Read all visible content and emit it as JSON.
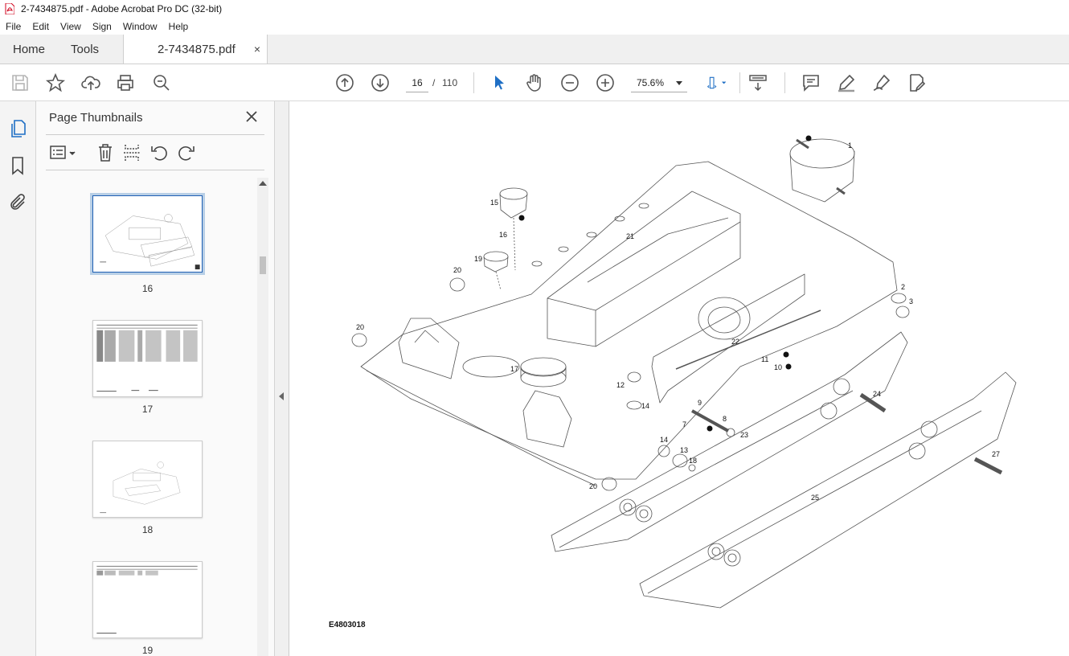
{
  "window": {
    "title": "2-7434875.pdf - Adobe Acrobat Pro DC (32-bit)"
  },
  "menu": [
    "File",
    "Edit",
    "View",
    "Sign",
    "Window",
    "Help"
  ],
  "tabs": {
    "home": "Home",
    "tools": "Tools",
    "document": "2-7434875.pdf",
    "close": "×"
  },
  "nav": {
    "current_page": "16",
    "separator": "/",
    "total_pages": "110",
    "zoom": "75.6%"
  },
  "panel": {
    "title": "Page Thumbnails"
  },
  "thumbnails": [
    {
      "label": "16",
      "selected": true
    },
    {
      "label": "17",
      "selected": false
    },
    {
      "label": "18",
      "selected": false
    },
    {
      "label": "19",
      "selected": false
    }
  ],
  "document": {
    "figure_code": "E4803018",
    "callouts": [
      "1",
      "2",
      "3",
      "7",
      "8",
      "9",
      "10",
      "11",
      "12",
      "13",
      "14",
      "14",
      "15",
      "16",
      "17",
      "18",
      "19",
      "20",
      "20",
      "20",
      "21",
      "22",
      "23",
      "24",
      "25",
      "27"
    ]
  },
  "icons": {
    "toolbar": [
      "save-icon",
      "bookmark-star-icon",
      "upload-icon",
      "print-icon",
      "zoom-search-icon",
      "page-up-icon",
      "page-down-icon",
      "select-cursor-icon",
      "hand-icon",
      "zoom-out-icon",
      "zoom-in-icon",
      "fit-page-icon",
      "scroll-mode-icon",
      "comment-icon",
      "highlight-icon",
      "sign-icon",
      "edit-pdf-icon"
    ],
    "rail": [
      "pages-icon",
      "bookmarks-icon",
      "attachments-icon"
    ],
    "panel": [
      "options-menu-icon",
      "delete-icon",
      "extract-icon",
      "rotate-left-icon",
      "rotate-right-icon"
    ]
  },
  "colors": {
    "accent": "#1f6fc5",
    "pdf_red": "#d0021b"
  }
}
